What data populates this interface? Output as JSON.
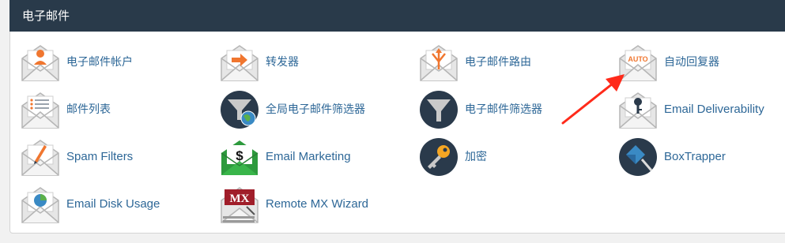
{
  "panel": {
    "title": "电子邮件"
  },
  "items": [
    {
      "label": "电子邮件帐户",
      "icon": "email-accounts-icon"
    },
    {
      "label": "转发器",
      "icon": "forwarders-icon"
    },
    {
      "label": "电子邮件路由",
      "icon": "email-routing-icon"
    },
    {
      "label": "自动回复器",
      "icon": "autoresponders-icon",
      "icon_text": "AUTO"
    },
    {
      "label": "邮件列表",
      "icon": "mailing-lists-icon"
    },
    {
      "label": "全局电子邮件筛选器",
      "icon": "global-email-filters-icon"
    },
    {
      "label": "电子邮件筛选器",
      "icon": "email-filters-icon"
    },
    {
      "label": "Email Deliverability",
      "icon": "email-deliverability-icon"
    },
    {
      "label": "Spam Filters",
      "icon": "spam-filters-icon"
    },
    {
      "label": "Email Marketing",
      "icon": "email-marketing-icon",
      "icon_text": "$"
    },
    {
      "label": "加密",
      "icon": "encryption-key-icon"
    },
    {
      "label": "BoxTrapper",
      "icon": "boxtrapper-icon"
    },
    {
      "label": "Email Disk Usage",
      "icon": "email-disk-usage-icon"
    },
    {
      "label": "Remote MX Wizard",
      "icon": "remote-mx-wizard-icon",
      "icon_text": "MX"
    }
  ],
  "colors": {
    "header_bg": "#293a4a",
    "link": "#2d6797",
    "accent_orange": "#f0762f",
    "annotation_red": "#ff2a1a"
  }
}
